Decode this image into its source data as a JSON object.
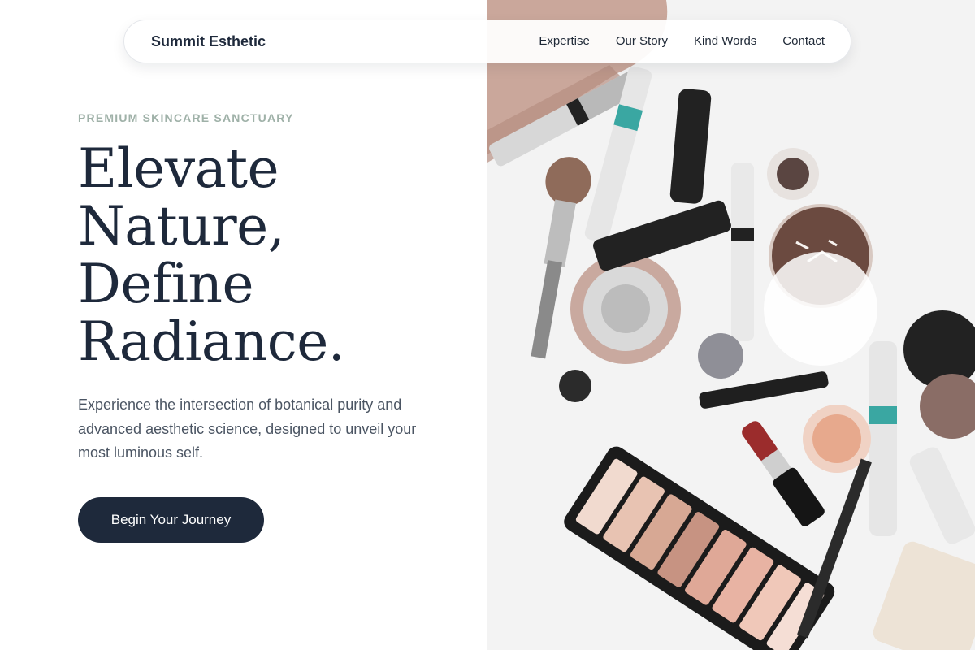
{
  "nav": {
    "brand": "Summit Esthetic",
    "links": [
      "Expertise",
      "Our Story",
      "Kind Words",
      "Contact"
    ]
  },
  "hero": {
    "eyebrow": "PREMIUM SKINCARE SANCTUARY",
    "headline_lines": [
      "Elevate",
      "Nature,",
      "Define",
      "Radiance."
    ],
    "description": "Experience the intersection of botanical purity and advanced aesthetic science, designed to unveil your most luminous self.",
    "cta_label": "Begin Your Journey"
  },
  "image": {
    "subject": "makeup-products-flatlay",
    "colors": {
      "background": "#f3f3f3",
      "accent_teal": "#3aa7a2",
      "palette_dark": "#1b1b1b",
      "lipstick": "#9b2c2c"
    }
  }
}
